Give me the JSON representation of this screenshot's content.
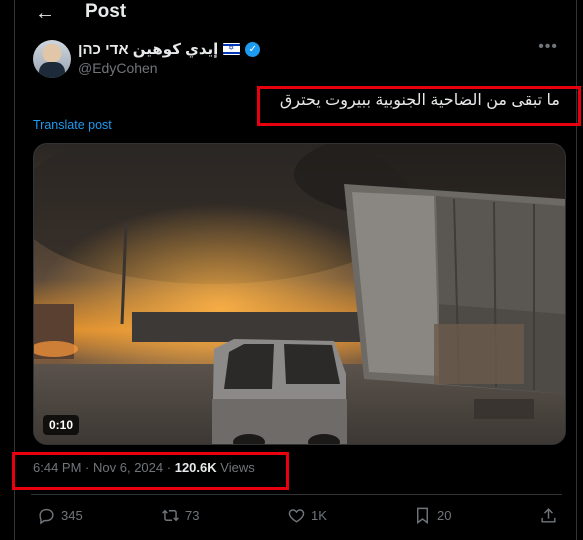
{
  "header": {
    "back_icon": "arrow-left-icon",
    "title": "Post"
  },
  "author": {
    "display_name": "إيدي كوهين אדי כהן",
    "handle": "@EdyCohen",
    "flag_icon": "israel-flag-icon",
    "verified_icon": "verified-badge-icon",
    "more_icon": "more-horizontal-icon"
  },
  "tweet": {
    "text": "ما تبقى من الضاحية الجنوبية ببيروت يحترق",
    "translate_label": "Translate post"
  },
  "media": {
    "type": "video",
    "duration": "0:10"
  },
  "meta": {
    "time": "6:44 PM",
    "separator": "·",
    "date": "Nov 6, 2024",
    "views_count": "120.6K",
    "views_label": "Views"
  },
  "actions": {
    "replies": "345",
    "reposts": "73",
    "likes": "1K",
    "bookmarks": "20"
  },
  "colors": {
    "accent": "#1d9bf0",
    "highlight": "#e8000e",
    "muted": "#71767b",
    "background": "#000000"
  }
}
